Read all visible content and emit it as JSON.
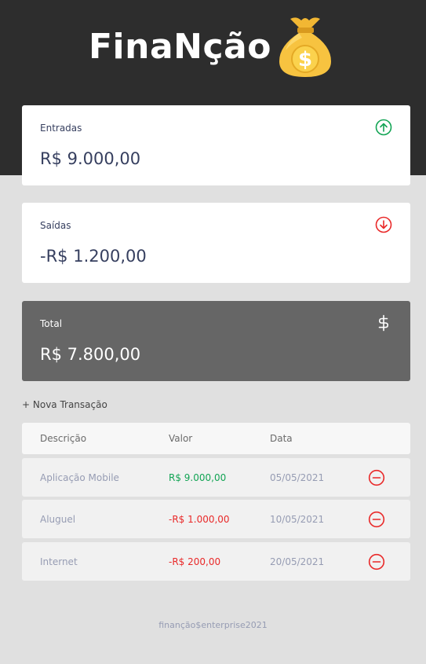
{
  "header": {
    "logo_text": "FinaNção",
    "logo_icon": "money-bag-dollar-icon"
  },
  "cards": {
    "income": {
      "label": "Entradas",
      "value": "R$ 9.000,00",
      "icon": "arrow-up-circle-icon",
      "color": "#12a454"
    },
    "expense": {
      "label": "Saídas",
      "value": "-R$ 1.200,00",
      "icon": "arrow-down-circle-icon",
      "color": "#e92929"
    },
    "total": {
      "label": "Total",
      "value": "R$ 7.800,00",
      "icon": "dollar-sign-icon",
      "color": "#666666"
    }
  },
  "new_transaction_label": "+ Nova Transação",
  "table": {
    "headers": [
      "Descrição",
      "Valor",
      "Data"
    ],
    "rows": [
      {
        "description": "Aplicação Mobile",
        "amount": "R$ 9.000,00",
        "date": "05/05/2021",
        "type": "income"
      },
      {
        "description": "Aluguel",
        "amount": "-R$ 1.000,00",
        "date": "10/05/2021",
        "type": "expense"
      },
      {
        "description": "Internet",
        "amount": "-R$ 200,00",
        "date": "20/05/2021",
        "type": "expense"
      }
    ],
    "remove_icon": "minus-circle-icon"
  },
  "footer": "finanção$enterprise2021"
}
